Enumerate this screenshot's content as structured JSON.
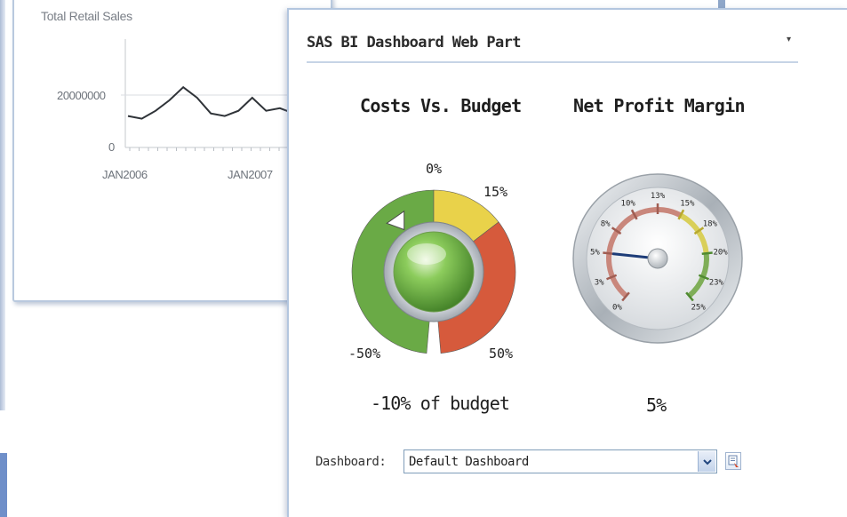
{
  "background_chart": {
    "title": "Total Retail Sales",
    "chart_data": {
      "type": "line",
      "title": "Total Retail Sales",
      "x_tick_labels": [
        "JAN2006",
        "JAN2007"
      ],
      "y_tick_labels": [
        "20000000",
        "0"
      ],
      "ylim": [
        0,
        20000000
      ],
      "series": [
        {
          "values": [
            12000000,
            11000000,
            14000000,
            18000000,
            23000000,
            19000000,
            13000000,
            12000000,
            14000000,
            19000000,
            14000000,
            15000000,
            13000000,
            17000000
          ]
        }
      ],
      "grid": false
    }
  },
  "webpart": {
    "title": "SAS BI Dashboard Web Part",
    "menu_glyph": "▾"
  },
  "gauges": [
    {
      "title": "Costs Vs. Budget",
      "caption": "-10% of budget",
      "labels": [
        "0%",
        "15%",
        "-50%",
        "50%"
      ],
      "value_percent": -10,
      "range_min": -50,
      "range_max": 50,
      "bands": [
        {
          "from": -50,
          "to": 0,
          "color": "#6aaa46"
        },
        {
          "from": 0,
          "to": 15,
          "color": "#e9d24a"
        },
        {
          "from": 15,
          "to": 50,
          "color": "#d65a3c"
        }
      ]
    },
    {
      "title": "Net Profit Margin",
      "caption": "5%",
      "tick_labels": [
        "0%",
        "3%",
        "5%",
        "8%",
        "10%",
        "13%",
        "15%",
        "18%",
        "20%",
        "23%",
        "25%"
      ],
      "value_percent": 5,
      "bands": [
        {
          "from": 0,
          "to": 15,
          "color": "#c9877c"
        },
        {
          "from": 15,
          "to": 20,
          "color": "#d9cf59"
        },
        {
          "from": 20,
          "to": 25,
          "color": "#7fae58"
        }
      ]
    }
  ],
  "dashboard_selector": {
    "label": "Dashboard:",
    "value": "Default Dashboard"
  },
  "icons": {
    "dropdown": "chevron-down-icon",
    "apply": "apply-dashboard-icon",
    "menu": "web-part-menu-icon"
  }
}
